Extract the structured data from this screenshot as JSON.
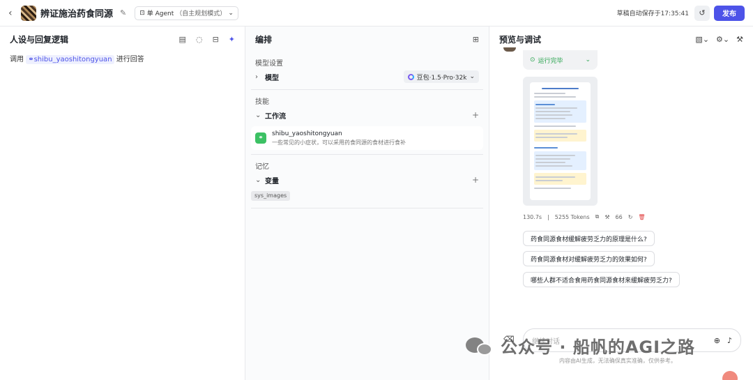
{
  "header": {
    "title": "辨证施治药食同源",
    "mode_label": "单 Agent",
    "mode_sub": "（自主规划模式）",
    "autosave": "草稿自动保存于17:35:41",
    "publish_label": "发布"
  },
  "persona": {
    "title": "人设与回复逻辑",
    "prompt_prefix": "调用",
    "workflow_ref": "shibu_yaoshitongyuan",
    "prompt_suffix": "进行回答"
  },
  "arrange": {
    "title": "编排",
    "model_section": "模型设置",
    "model_label": "模型",
    "model_value": "豆包·1.5·Pro·32k",
    "skills_section": "技能",
    "workflow_label": "工作流",
    "workflow_name": "shibu_yaoshitongyuan",
    "workflow_desc": "一些常见的小症状，可以采用药食同源的食材进行食补",
    "memory_section": "记忆",
    "variable_label": "变量",
    "variable_chip": "sys_images"
  },
  "preview": {
    "title": "预览与调试",
    "run_status": "运行完毕",
    "stats_time": "130.7s",
    "stats_sep": "|",
    "stats_tokens": "5255 Tokens",
    "stats_count": "66",
    "suggestions": [
      "药食同源食材缓解疲劳乏力的原理是什么?",
      "药食同源食材对缓解疲劳乏力的效果如何?",
      "哪些人群不适合食用药食同源食材来缓解疲劳乏力?"
    ],
    "input_placeholder": "继续对话",
    "disclaimer": "内容由AI生成，无法确保真实准确，仅供参考。"
  },
  "watermark": {
    "text": "公众号 · 船帆的AGI之路"
  },
  "colors": {
    "brand": "#4d53e8",
    "success": "#2aa44f",
    "danger": "#e03e3e"
  }
}
